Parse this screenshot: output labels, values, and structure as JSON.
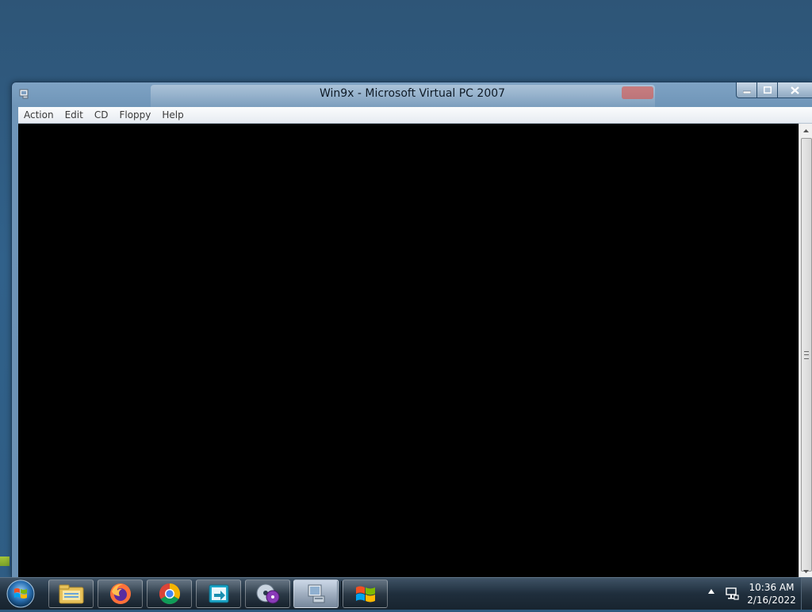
{
  "window": {
    "title": "Win9x - Microsoft Virtual PC 2007",
    "controls": {
      "minimize": "minimize",
      "maximize": "maximize",
      "close": "close"
    }
  },
  "menubar": {
    "items": [
      "Action",
      "Edit",
      "CD",
      "Floppy",
      "Help"
    ]
  },
  "taskbar": {
    "start_icon": "windows-orb-icon",
    "pinned": [
      {
        "icon": "file-explorer-icon",
        "active": false
      },
      {
        "icon": "firefox-icon",
        "active": false
      },
      {
        "icon": "chrome-icon",
        "active": false
      },
      {
        "icon": "remote-app-icon",
        "active": false
      },
      {
        "icon": "disc-burner-icon",
        "active": false
      },
      {
        "icon": "virtual-pc-icon",
        "active": true
      },
      {
        "icon": "windows-flag-icon",
        "active": false
      }
    ]
  },
  "tray": {
    "time": "10:36 AM",
    "date": "2/16/2022"
  },
  "colors": {
    "desktop": "#2f5a7f",
    "vm_screen": "#000000",
    "taskbar": "#1f2e3c"
  }
}
